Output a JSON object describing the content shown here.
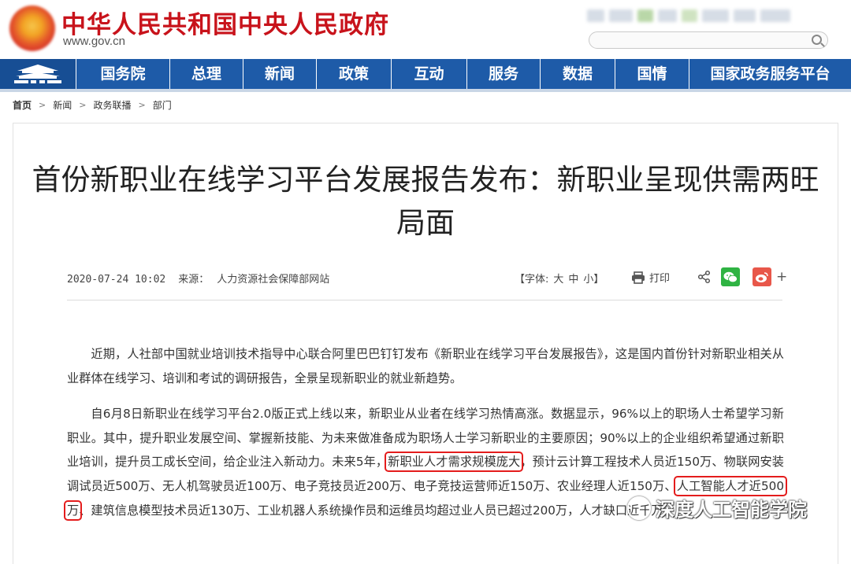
{
  "site": {
    "title": "中华人民共和国中央人民政府",
    "url": "www.gov.cn"
  },
  "nav": {
    "items": [
      "国务院",
      "总理",
      "新闻",
      "政策",
      "互动",
      "服务",
      "数据",
      "国情",
      "国家政务服务平台"
    ]
  },
  "breadcrumb": {
    "items": [
      "首页",
      "新闻",
      "政务联播",
      "部门"
    ]
  },
  "article": {
    "title": "首份新职业在线学习平台发展报告发布：新职业呈现供需两旺局面",
    "date": "2020-07-24 10:02",
    "source_label": "来源：",
    "source": "人力资源社会保障部网站",
    "font_label": "【字体:",
    "font_sizes": [
      "大",
      "中",
      "小】"
    ],
    "print_label": "打印",
    "p1": "近期，人社部中国就业培训技术指导中心联合阿里巴巴钉钉发布《新职业在线学习平台发展报告》，这是国内首份针对新职业相关从业群体在线学习、培训和考试的调研报告，全景呈现新职业的就业新趋势。",
    "p2_a": "自6月8日新职业在线学习平台2.0版正式上线以来，新职业从业者在线学习热情高涨。数据显示，96%以上的职场人士希望学习新职业。其中，提升职业发展空间、掌握新技能、为未来做准备成为职场人士学习新职业的主要原因；90%以上的企业组织希望通过新职业培训，提升员工成长空间，给企业注入新动力。未来5年，",
    "p2_hl1": "新职业人才需求规模庞大",
    "p2_b": "，预计云计算工程技术人员近150万、物联网安装调试员近500万、无人机驾驶员近100万、电子竞技员近200万、电子竞技运营师近150万、农业经理人近150万、",
    "p2_hl2": "人工智能人才近500万",
    "p2_c": "、建筑信息模型技术员近130万、工业机器人系统操作员和运维员均超过",
    "p2_d": "业人员已超过200万，人才缺口近千万。"
  },
  "watermark": {
    "text": "深度人工智能学院"
  },
  "colors": {
    "brand_red": "#c8131b",
    "nav_blue": "#1e5ba8",
    "highlight_red": "#e41c1c"
  }
}
